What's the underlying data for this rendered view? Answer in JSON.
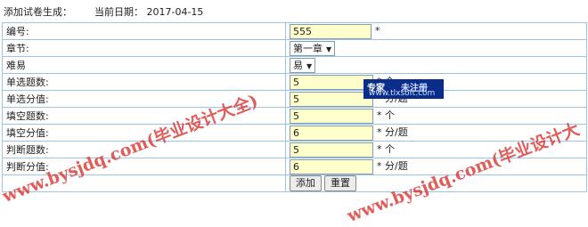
{
  "header": {
    "title": "添加试卷生成：",
    "date_label": "当前日期：",
    "date_value": "2017-04-15"
  },
  "form": {
    "rows": [
      {
        "label": "编号:",
        "kind": "input",
        "value": "555",
        "required": "*"
      },
      {
        "label": "章节:",
        "kind": "select",
        "value": "第一章"
      },
      {
        "label": "难易",
        "kind": "select",
        "value": "易"
      },
      {
        "label": "单选题数:",
        "kind": "input",
        "value": "5",
        "required": "*",
        "unit": "个"
      },
      {
        "label": "单选分值:",
        "kind": "input",
        "value": "5",
        "required": "*",
        "unit": "分/题"
      },
      {
        "label": "填空题数:",
        "kind": "input",
        "value": "5",
        "required": "*",
        "unit": "个"
      },
      {
        "label": "填空分值:",
        "kind": "input",
        "value": "6",
        "required": "*",
        "unit": "分/题"
      },
      {
        "label": "判断题数:",
        "kind": "input",
        "value": "5",
        "required": "*",
        "unit": "个"
      },
      {
        "label": "判断分值:",
        "kind": "input",
        "value": "6",
        "required": "*",
        "unit": "分/题"
      }
    ],
    "buttons": {
      "submit": "添加",
      "reset": "重置"
    }
  },
  "overlays": {
    "watermark_text": "www.bysjdq.com(毕业设计大全)",
    "watermark_text_2": "www.bysjdq.com(毕业设计大",
    "badge_left": "专家",
    "badge_right": "未注册",
    "badge_url": "www.tlxsoft.com",
    "colors": {
      "watermark": "#d9302b",
      "badge_bg": "#0a2d8a",
      "input_bg": "#ffffcc",
      "border": "#9cc3e8"
    }
  }
}
